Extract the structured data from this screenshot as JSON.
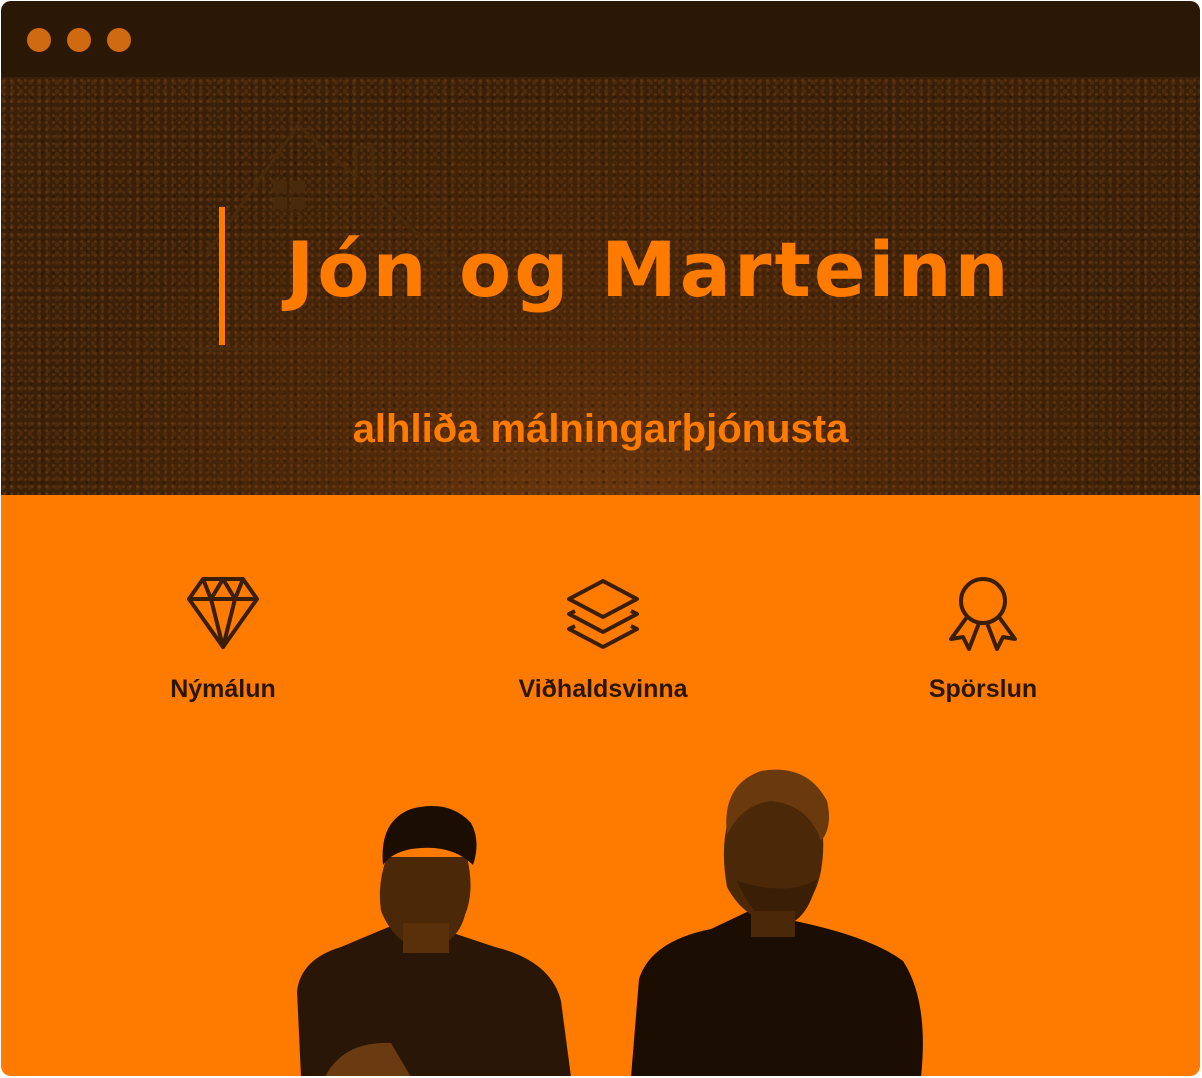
{
  "window": {
    "controls": [
      "close-dot",
      "minimize-dot",
      "maximize-dot"
    ]
  },
  "hero": {
    "brand_name": "Jón og Marteinn",
    "tagline": "alhliða málningarþjónusta"
  },
  "services": [
    {
      "icon": "diamond-icon",
      "label": "Nýmálun"
    },
    {
      "icon": "layers-icon",
      "label": "Viðhaldsvinna"
    },
    {
      "icon": "award-ribbon-icon",
      "label": "Spörslun"
    }
  ],
  "colors": {
    "accent": "#ff7b00",
    "dark": "#2a1704",
    "icon_stroke": "#3a1e06"
  }
}
